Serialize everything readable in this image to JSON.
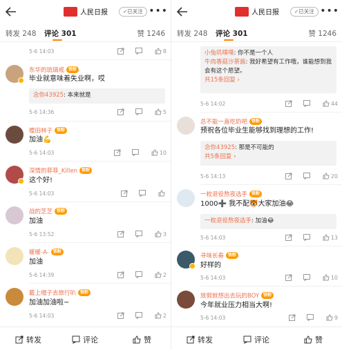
{
  "header": {
    "brand_name": "人民日报",
    "follow_label": "已关注",
    "more_label": "•••"
  },
  "tabs": {
    "repost": "转发 248",
    "comments": "评论 301",
    "likes": "赞 1246"
  },
  "bottombar": {
    "repost": "转发",
    "comment": "评论",
    "like": "赞"
  },
  "left": {
    "top_meta": {
      "date": "5-6 14:03",
      "likes": "8"
    },
    "comments": [
      {
        "user": "东华的琉璃戒",
        "badge": "铁粉",
        "text": "毕业就意味着失业啊，哎",
        "reply_user": "念你43925",
        "reply_text": ": 本来就是",
        "date": "5-6 14:36",
        "likes": "5",
        "avatar_color": "#c9a27e"
      },
      {
        "user": "樱田林子",
        "badge": "铁粉",
        "text": "加油💪",
        "date": "5-6 14:03",
        "likes": "10",
        "avatar_color": "#6b4b3e"
      },
      {
        "user": "深情的菲菲_Killen",
        "badge": "铁粉",
        "text": "这个好!",
        "date": "5-6 14:03",
        "likes": "",
        "avatar_color": "#b24a4a"
      },
      {
        "user": "战的芝芝",
        "badge": "铁粉",
        "text": "加油",
        "date": "5-6 13:52",
        "likes": "3",
        "avatar_color": "#d8c8d4"
      },
      {
        "user": "暖暖-A-",
        "badge": "铁粉",
        "text": "加油",
        "date": "5-6 14:39",
        "likes": "2",
        "avatar_color": "#f2e3b8"
      },
      {
        "user": "戴上帽子去旅行叭",
        "badge": "铁粉",
        "text": "加油加油啦~",
        "date": "5-6 14:03",
        "likes": "2",
        "avatar_color": "#c98a3c"
      }
    ]
  },
  "right": {
    "thread": {
      "r1_user": "小兔叽噗噗",
      "r1_text": ": 你不是一个人",
      "r2_user": "牛肉香菇沙茶酱",
      "r2_text": ": 我好希望有工作哦，谁能想到我会有这个愿望。",
      "more": "共15条回复 ›",
      "date": "5-6 14:02",
      "likes": "44"
    },
    "comments": [
      {
        "user": "总不能一直吃奶吧",
        "badge": "铁粉",
        "text": "预祝各位毕业生能够找到理想的工作!",
        "reply_user": "念你43925",
        "reply_text": ": 那是不可能的",
        "reply_more": "共5条回复 ›",
        "date": "5-6 14:13",
        "likes": "20",
        "avatar_color": "#e8e0d8"
      },
      {
        "user": "一枚退役熬夜选手",
        "badge": "铁粉",
        "text": "1000➕ 我不配🐯大家加油😂",
        "reply_user": "一枚退役熬夜选手",
        "reply_text": ": 加油😂",
        "date": "5-6 14:03",
        "likes": "13",
        "avatar_color": "#dfe9f2"
      },
      {
        "user": "寻味长春",
        "badge": "铁粉",
        "text": "好样的",
        "date": "5-6 14:03",
        "likes": "10",
        "avatar_color": "#3a5a6a"
      },
      {
        "user": "放假就想出去玩的BOY",
        "badge": "铁粉",
        "text": "今年就业压力相当大啊!",
        "date": "5-6 14:03",
        "likes": "9",
        "avatar_color": "#7a4a3a"
      }
    ]
  }
}
